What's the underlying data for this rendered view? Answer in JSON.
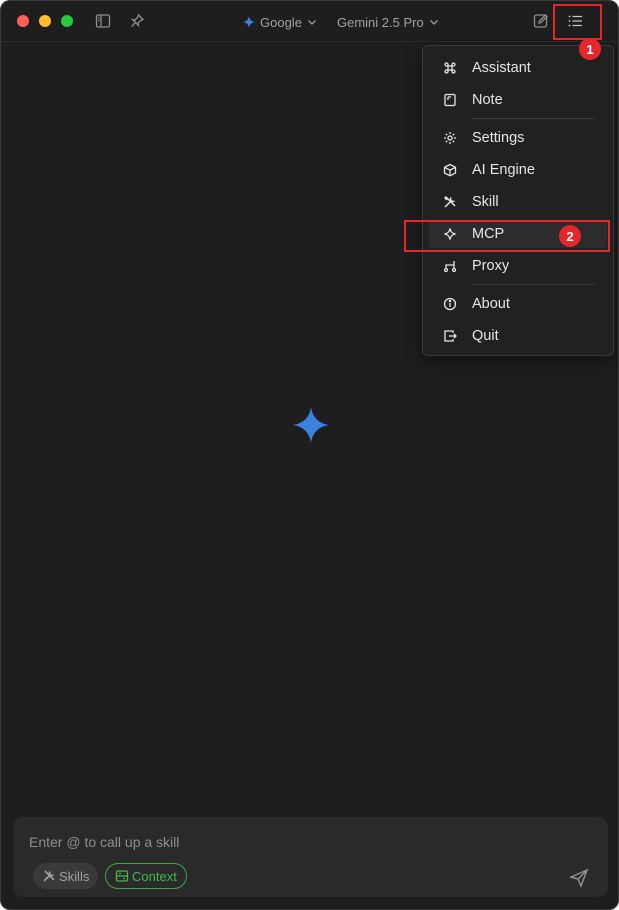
{
  "titlebar": {
    "provider": "Google",
    "model": "Gemini 2.5 Pro"
  },
  "menu": {
    "items": [
      {
        "label": "Assistant",
        "icon": "command-icon"
      },
      {
        "label": "Note",
        "icon": "note-icon"
      },
      {
        "label": "Settings",
        "icon": "gear-icon"
      },
      {
        "label": "AI Engine",
        "icon": "cube-icon"
      },
      {
        "label": "Skill",
        "icon": "tools-icon"
      },
      {
        "label": "MCP",
        "icon": "mcp-icon"
      },
      {
        "label": "Proxy",
        "icon": "proxy-icon"
      },
      {
        "label": "About",
        "icon": "info-icon"
      },
      {
        "label": "Quit",
        "icon": "exit-icon"
      }
    ]
  },
  "annotations": {
    "step1": "1",
    "step2": "2"
  },
  "composer": {
    "placeholder": "Enter @ to call up a skill",
    "skills_label": "Skills",
    "context_label": "Context"
  },
  "colors": {
    "accent_red": "#e5262a",
    "context_green": "#48b54f",
    "gemini_blue": "#3b82e0"
  }
}
